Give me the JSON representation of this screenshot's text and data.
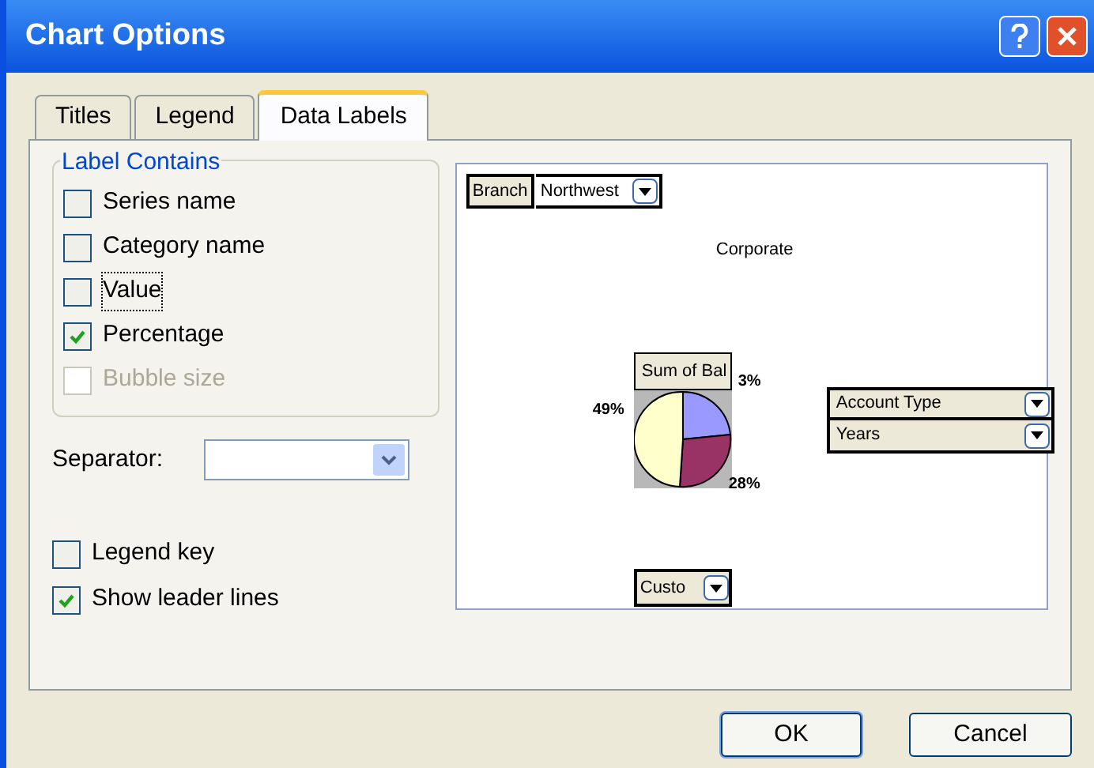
{
  "window": {
    "title": "Chart Options"
  },
  "tabs": [
    {
      "label": "Titles",
      "selected": false
    },
    {
      "label": "Legend",
      "selected": false
    },
    {
      "label": "Data Labels",
      "selected": true
    }
  ],
  "label_contains": {
    "title": "Label Contains",
    "options": [
      {
        "label": "Series name",
        "checked": false,
        "disabled": false,
        "focused": false
      },
      {
        "label": "Category name",
        "checked": false,
        "disabled": false,
        "focused": false
      },
      {
        "label": "Value",
        "checked": false,
        "disabled": false,
        "focused": true
      },
      {
        "label": "Percentage",
        "checked": true,
        "disabled": false,
        "focused": false
      },
      {
        "label": "Bubble size",
        "checked": false,
        "disabled": true,
        "focused": false
      }
    ]
  },
  "separator": {
    "label": "Separator:"
  },
  "options": [
    {
      "label": "Legend key",
      "checked": false
    },
    {
      "label": "Show leader lines",
      "checked": true
    }
  ],
  "preview": {
    "page_field": {
      "name": "Branch",
      "value": "Northwest"
    },
    "chart_title": "Corporate",
    "data_field": "Sum of Bal",
    "slice_labels": [
      "3%",
      "49%",
      "28%"
    ],
    "series_fields": [
      "Account Type",
      "Years"
    ],
    "category_field": "Custo"
  },
  "buttons": [
    "OK",
    "Cancel"
  ]
}
